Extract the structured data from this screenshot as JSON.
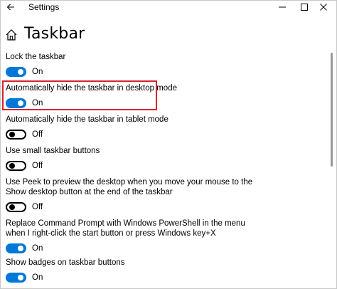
{
  "window": {
    "title": "Settings"
  },
  "page": {
    "title": "Taskbar"
  },
  "accent_color": "#0078d7",
  "highlight_color": "#d9232e",
  "settings": [
    {
      "label": "Lock the taskbar",
      "state": "On",
      "on": true
    },
    {
      "label": "Automatically hide the taskbar in desktop mode",
      "state": "On",
      "on": true
    },
    {
      "label": "Automatically hide the taskbar in tablet mode",
      "state": "Off",
      "on": false
    },
    {
      "label": "Use small taskbar buttons",
      "state": "Off",
      "on": false
    },
    {
      "label_line1": "Use Peek to preview the desktop when you move your mouse to the",
      "label_line2": "Show desktop button at the end of the taskbar",
      "state": "Off",
      "on": false
    },
    {
      "label_line1": "Replace Command Prompt with Windows PowerShell in the menu",
      "label_line2": "when I right-click the start button or press Windows key+X",
      "state": "On",
      "on": true
    },
    {
      "label": "Show badges on taskbar buttons",
      "state": "On",
      "on": true
    }
  ]
}
